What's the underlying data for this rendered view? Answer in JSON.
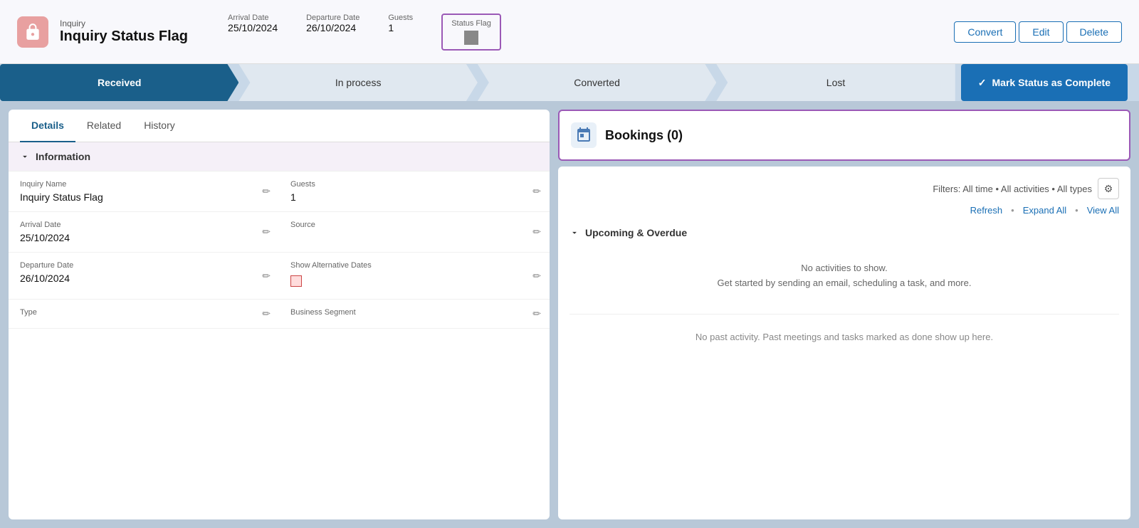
{
  "header": {
    "app_label": "Inquiry",
    "title": "Inquiry Status Flag",
    "arrival_date_label": "Arrival Date",
    "arrival_date_value": "25/10/2024",
    "departure_date_label": "Departure Date",
    "departure_date_value": "26/10/2024",
    "guests_label": "Guests",
    "guests_value": "1",
    "status_flag_label": "Status Flag",
    "convert_label": "Convert",
    "edit_label": "Edit",
    "delete_label": "Delete"
  },
  "status_bar": {
    "steps": [
      "Received",
      "In process",
      "Converted",
      "Lost"
    ],
    "mark_complete_label": "Mark Status as Complete"
  },
  "tabs": {
    "items": [
      "Details",
      "Related",
      "History"
    ],
    "active": "Details"
  },
  "information": {
    "section_label": "Information",
    "fields": {
      "inquiry_name_label": "Inquiry Name",
      "inquiry_name_value": "Inquiry Status Flag",
      "guests_label": "Guests",
      "guests_value": "1",
      "arrival_date_label": "Arrival Date",
      "arrival_date_value": "25/10/2024",
      "source_label": "Source",
      "source_value": "",
      "departure_date_label": "Departure Date",
      "departure_date_value": "26/10/2024",
      "show_alt_dates_label": "Show Alternative Dates",
      "type_label": "Type",
      "type_value": "",
      "business_segment_label": "Business Segment",
      "business_segment_value": ""
    }
  },
  "bookings": {
    "title": "Bookings (0)"
  },
  "activity": {
    "filters_text": "Filters: All time • All activities • All types",
    "refresh_label": "Refresh",
    "expand_all_label": "Expand All",
    "view_all_label": "View All",
    "upcoming_label": "Upcoming & Overdue",
    "no_activities_line1": "No activities to show.",
    "no_activities_line2": "Get started by sending an email, scheduling a task, and more.",
    "no_past_activity": "No past activity. Past meetings and tasks marked as done show up here."
  }
}
